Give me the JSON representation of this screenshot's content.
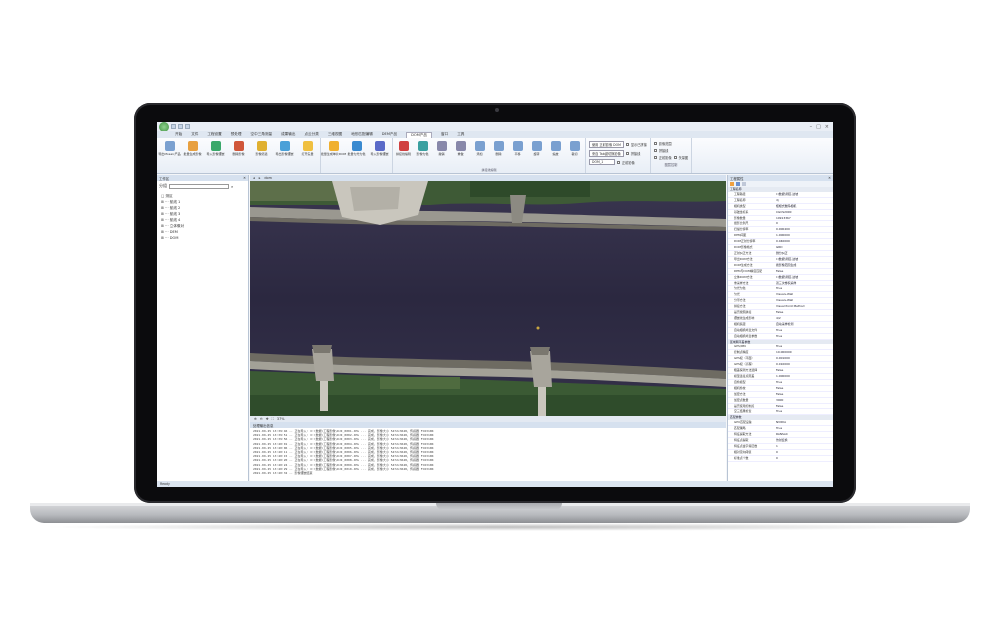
{
  "app": {
    "window_controls": [
      "–",
      "□",
      "×"
    ]
  },
  "menu": {
    "items": [
      "开始",
      "文件",
      "工程设置",
      "预处理",
      "空中三角测量",
      "成果输出",
      "点云分类",
      "三维视图",
      "地形匹配编辑",
      "DEM产品",
      "DOM产品",
      "窗口",
      "工具"
    ],
    "active_index": 10
  },
  "ribbon": {
    "group1": [
      {
        "label": "导出Mosaic产品",
        "color": "#7aa0d0"
      },
      {
        "label": "批量生成影像",
        "color": "#e8a040"
      },
      {
        "label": "导入影像镶嵌",
        "color": "#3aa86a"
      },
      {
        "label": "删除影像",
        "color": "#d0563a"
      },
      {
        "label": "影像筛选",
        "color": "#e0b030"
      },
      {
        "label": "导出影像镶嵌",
        "color": "#4aa0d8"
      },
      {
        "label": "打开矢量",
        "color": "#f0c040"
      }
    ],
    "group2": [
      {
        "label": "批量生成单片DOM",
        "color": "#f0b030"
      },
      {
        "label": "批量匀光匀色",
        "color": "#3a8ad0"
      },
      {
        "label": "导入影像镶嵌",
        "color": "#5a6ac8"
      }
    ],
    "group3": [
      {
        "label": "拼接线编辑",
        "color": "#d04040"
      },
      {
        "label": "影像匀色",
        "color": "#3aa0a0"
      },
      {
        "label": "撤销",
        "color": "#8888aa"
      },
      {
        "label": "重做",
        "color": "#8888aa"
      },
      {
        "label": "添加",
        "color": "#7aa0d0"
      },
      {
        "label": "删除",
        "color": "#7aa0d0"
      },
      {
        "label": "平移",
        "color": "#7aa0d0"
      },
      {
        "label": "旋转",
        "color": "#7aa0d0"
      },
      {
        "label": "缩放",
        "color": "#7aa0d0"
      },
      {
        "label": "裁切",
        "color": "#7aa0d0"
      }
    ],
    "group3_caption": "拼接线编辑",
    "options": {
      "row1": "使用 正射影像 DOM",
      "row2": "来自 Tab键切换影像",
      "row3": "DOM_1",
      "check1": "显示已拼接",
      "check2": "拼接线",
      "check3": "正射影像",
      "check4": "影像范围",
      "check5": "拼接线",
      "check6": "正射影像",
      "check7": "矢量图",
      "caption": "图层控制"
    }
  },
  "left_panel": {
    "title": "工作区",
    "search_label": "分组",
    "tree": [
      "□ 测区",
      "⊞ ··· 航线 1",
      "⊞ ··· 航线 2",
      "⊞ ··· 航线 3",
      "⊞ ··· 航线 4",
      "⊞ ··· 立体像对",
      "⊞ ··· DEM",
      "⊞ ··· DOM"
    ],
    "tabs": [
      "工作区",
      "影像控制点"
    ]
  },
  "doc": {
    "tab": "dom",
    "zoom": "37%"
  },
  "log": {
    "title": "处理输出信息",
    "lines": [
      "2021-09-25 13:39:46 -- 正在导入: I:\\数据\\工程影像\\DJI_0001.JPG ... 完成，影像大小 5472×3648，传感器 FC6310R",
      "2021-09-25 13:39:51 -- 正在导入: I:\\数据\\工程影像\\DJI_0002.JPG ... 完成，影像大小 5472×3648，传感器 FC6310R",
      "2021-09-25 13:39:56 -- 正在导入: I:\\数据\\工程影像\\DJI_0003.JPG ... 完成，影像大小 5472×3648，传感器 FC6310R",
      "2021-09-25 13:40:01 -- 正在导入: I:\\数据\\工程影像\\DJI_0004.JPG ... 完成，影像大小 5472×3648，传感器 FC6310R",
      "2021-09-25 13:40:06 -- 正在导入: I:\\数据\\工程影像\\DJI_0005.JPG ... 完成，影像大小 5472×3648，传感器 FC6310R",
      "2021-09-25 13:40:11 -- 正在导入: I:\\数据\\工程影像\\DJI_0006.JPG ... 完成，影像大小 5472×3648，传感器 FC6310R",
      "2021-09-25 13:40:15 -- 正在导入: I:\\数据\\工程影像\\DJI_0007.JPG ... 完成，影像大小 5472×3648，传感器 FC6310R",
      "2021-09-25 13:40:20 -- 正在导入: I:\\数据\\工程影像\\DJI_0008.JPG ... 完成，影像大小 5472×3648，传感器 FC6310R",
      "2021-09-25 13:40:24 -- 正在导入: I:\\数据\\工程影像\\DJI_0009.JPG ... 完成，影像大小 5472×3648，传感器 FC6310R",
      "2021-09-25 13:40:29 -- 正在导入: I:\\数据\\工程影像\\DJI_0010.JPG ... 完成，影像大小 5472×3648，传感器 FC6310R",
      "2021-09-25 13:40:32 -- 影像镶嵌结束"
    ]
  },
  "right_panel": {
    "title": "工程属性",
    "rows": [
      {
        "k": "工程名称",
        "v": "",
        "cat": true
      },
      {
        "k": "工程路径",
        "v": "I:\\数据\\测区-边坡"
      },
      {
        "k": "工程名称",
        "v": "dj"
      },
      {
        "k": "相机类型",
        "v": "框幅式数码相机"
      },
      {
        "k": "基础坐标系",
        "v": "CGCS2000"
      },
      {
        "k": "影像数量",
        "v": "10913367"
      },
      {
        "k": "摄影比例尺",
        "v": "0"
      },
      {
        "k": "扫描分辨率",
        "v": "0.000400"
      },
      {
        "k": "DEM间距",
        "v": "1.000000"
      },
      {
        "k": "DOM正射分辨率",
        "v": "0.040000"
      },
      {
        "k": "DOM影像格式",
        "v": "GRD"
      },
      {
        "k": "正射纠正方法",
        "v": "微分纠正"
      },
      {
        "k": "导出DOM方法",
        "v": "I:\\数据\\测区-边坡"
      },
      {
        "k": "DOM生成方法",
        "v": "按影像范围生成"
      },
      {
        "k": "DEM与DOM精度匹配",
        "v": "False"
      },
      {
        "k": "立体DOM方法",
        "v": "I:\\数据\\测区-边坡"
      },
      {
        "k": "重采样方法",
        "v": "双三次卷积采样"
      },
      {
        "k": "匀光匀色",
        "v": "True"
      },
      {
        "k": "匀光",
        "v": "Visual+Wall"
      },
      {
        "k": "分带方法",
        "v": "Visual+Wall"
      },
      {
        "k": "拼接方法",
        "v": "Visual Point Method"
      },
      {
        "k": "是否按照拼接",
        "v": "False"
      },
      {
        "k": "镶嵌线生成影响",
        "v": "4/2"
      },
      {
        "k": "相机焦距",
        "v": "自动采样检测"
      },
      {
        "k": "自动相机畸变文件",
        "v": "True"
      },
      {
        "k": "自动相机畸变参数",
        "v": "True"
      },
      {
        "k": "区域网平差参数",
        "v": "",
        "cat": true
      },
      {
        "k": "GPS/IMU",
        "v": "True"
      },
      {
        "k": "控制点精度",
        "v": "10.000000"
      },
      {
        "k": "GPS权（平面）",
        "v": "0.001000"
      },
      {
        "k": "GPS权（高程）",
        "v": "0.010000"
      },
      {
        "k": "粗差探测方法选择",
        "v": "False"
      },
      {
        "k": "模型连接点限差",
        "v": "1.000000"
      },
      {
        "k": "自检模型",
        "v": "True"
      },
      {
        "k": "相机检校",
        "v": "False"
      },
      {
        "k": "加密方法",
        "v": "False"
      },
      {
        "k": "加密点数量",
        "v": "3000"
      },
      {
        "k": "是否使用控制点",
        "v": "False"
      },
      {
        "k": "空三结果检查",
        "v": "True"
      },
      {
        "k": "匹配参数",
        "v": "",
        "cat": true
      },
      {
        "k": "GPU匹配设备",
        "v": "NVIDIA"
      },
      {
        "k": "匹配策略",
        "v": "True"
      },
      {
        "k": "特征提取方法",
        "v": "RANSAC"
      },
      {
        "k": "特征点提取",
        "v": "仿射变换"
      },
      {
        "k": "特征点金字塔层数",
        "v": "1"
      },
      {
        "k": "相对定向阈值",
        "v": "0"
      },
      {
        "k": "标准点个数",
        "v": "0"
      }
    ],
    "tabs": [
      "工程属性",
      "匹配预览列表"
    ]
  },
  "status": {
    "text": "Ready"
  }
}
